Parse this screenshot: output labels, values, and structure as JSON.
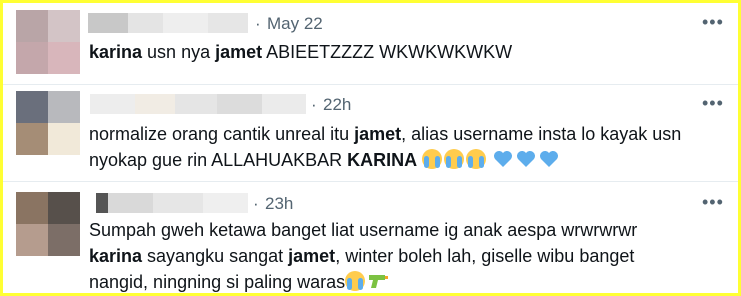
{
  "tweets": [
    {
      "separator": "·",
      "date": "May 22",
      "more_icon": "more-horizontal-icon",
      "text_parts": [
        {
          "t": "karina",
          "b": true
        },
        {
          "t": " usn nya ",
          "b": false
        },
        {
          "t": "jamet",
          "b": true
        },
        {
          "t": " ABIEETZZZZ WKWKWKWKW",
          "b": false
        }
      ]
    },
    {
      "separator": "·",
      "date": "22h",
      "more_icon": "more-horizontal-icon",
      "line1": [
        {
          "t": "normalize orang cantik unreal itu ",
          "b": false
        },
        {
          "t": "jamet",
          "b": true
        },
        {
          "t": ", alias username insta lo kayak usn",
          "b": false
        }
      ],
      "line2": [
        {
          "t": "nyokap gue rin ALLAHUAKBAR ",
          "b": false
        },
        {
          "t": "KARINA",
          "b": true
        },
        {
          "t": " ",
          "b": false
        }
      ],
      "emojis": [
        "loudly-crying-face-icon",
        "loudly-crying-face-icon",
        "loudly-crying-face-icon",
        "blue-heart-icon",
        "blue-heart-icon",
        "blue-heart-icon"
      ]
    },
    {
      "separator": "·",
      "date": "23h",
      "more_icon": "more-horizontal-icon",
      "line1": [
        {
          "t": "Sumpah gweh ketawa banget liat username ig anak aespa wrwrwrwr",
          "b": false
        }
      ],
      "line2": [
        {
          "t": "karina",
          "b": true
        },
        {
          "t": " sayangku sangat ",
          "b": false
        },
        {
          "t": "jamet",
          "b": true
        },
        {
          "t": ", winter boleh lah, giselle wibu banget",
          "b": false
        }
      ],
      "line3": [
        {
          "t": "nangid, ningning si paling waras",
          "b": false
        }
      ],
      "emojis": [
        "loudly-crying-face-icon",
        "water-pistol-icon"
      ]
    }
  ],
  "colors": {
    "border": "#ffff33",
    "text": "#0f1419",
    "secondary": "#536471",
    "heart": "#5dadec"
  }
}
